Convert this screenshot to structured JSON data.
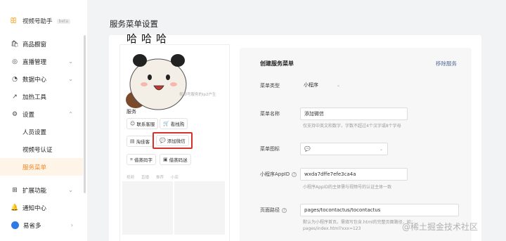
{
  "brand": {
    "name": "视频号助手",
    "tag": "beta"
  },
  "nav": {
    "items": [
      {
        "label": "商品橱窗",
        "icon": "shopping-bag-icon",
        "chevron": ""
      },
      {
        "label": "直播管理",
        "icon": "live-icon",
        "chevron": "⌄"
      },
      {
        "label": "数据中心",
        "icon": "chart-icon",
        "chevron": "⌄"
      },
      {
        "label": "加热工具",
        "icon": "trend-icon",
        "chevron": ""
      },
      {
        "label": "设置",
        "icon": "gear-icon",
        "chevron": "⌃"
      }
    ],
    "sub_items": [
      {
        "label": "人员设置"
      },
      {
        "label": "视频号认证"
      },
      {
        "label": "服务菜单",
        "active": true
      }
    ],
    "bottom": [
      {
        "label": "扩展功能",
        "icon": "extend-icon",
        "chevron": "⌄"
      },
      {
        "label": "通知中心",
        "icon": "bell-icon",
        "chevron": ""
      },
      {
        "label": "易省多",
        "icon": "avatar",
        "chevron": "›"
      }
    ]
  },
  "page_title": "服务菜单设置",
  "preview": {
    "meme_text": "哈哈哈",
    "caption": "视频号服务的ip2户生",
    "section_label": "服务",
    "buttons": [
      {
        "label": "联系客服",
        "icon": "chat-icon"
      },
      {
        "label": "看栈购",
        "icon": "cart-icon"
      },
      {
        "label": "淘佳客",
        "icon": "doc-icon"
      },
      {
        "label": "添加微信",
        "icon": "wechat-icon"
      },
      {
        "label": "借蒸码字",
        "icon": "code-icon"
      },
      {
        "label": "借蒸码迷",
        "icon": "image-icon"
      }
    ],
    "tabs": [
      "视频",
      "直播",
      "推荐",
      "小店"
    ]
  },
  "form": {
    "title": "创建服务菜单",
    "remove_label": "移除服务",
    "menu_type": {
      "label": "菜单类型",
      "value": "小程序"
    },
    "menu_name": {
      "label": "菜单名称",
      "value": "添加微信",
      "hint": "仅支持中英文和数字，字数不超过4个汉字或8个字母"
    },
    "menu_icon": {
      "label": "菜单图标",
      "value": "💬"
    },
    "appid": {
      "label": "小程序AppID",
      "value": "wxda7dffe7efe3ca4a",
      "hint": "小程序AppID的主体需与视频号的认证主体一致"
    },
    "page_path": {
      "label": "页面路径",
      "value": "pages/tocontactus/tocontactus",
      "hint1": "默认为小程序首页。需填写包含.html的完整页面路径，如：",
      "hint2": "pages/index.html?xxx=123"
    }
  },
  "watermark": "@稀土掘金技术社区"
}
